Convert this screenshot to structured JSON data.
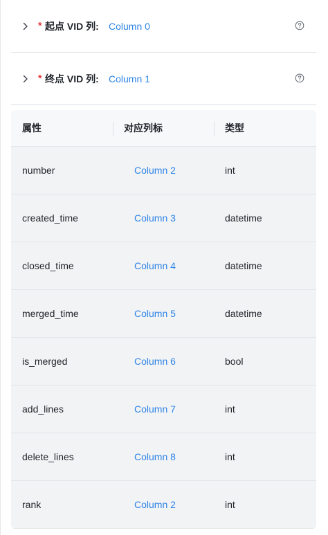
{
  "start_vid": {
    "required_mark": "*",
    "label": "起点 VID 列:",
    "value": "Column 0"
  },
  "end_vid": {
    "required_mark": "*",
    "label": "终点 VID 列:",
    "value": "Column 1"
  },
  "table": {
    "headers": {
      "property": "属性",
      "column": "对应列标",
      "type": "类型"
    },
    "rows": [
      {
        "property": "number",
        "column": "Column 2",
        "type": "int"
      },
      {
        "property": "created_time",
        "column": "Column 3",
        "type": "datetime"
      },
      {
        "property": "closed_time",
        "column": "Column 4",
        "type": "datetime"
      },
      {
        "property": "merged_time",
        "column": "Column 5",
        "type": "datetime"
      },
      {
        "property": "is_merged",
        "column": "Column 6",
        "type": "bool"
      },
      {
        "property": "add_lines",
        "column": "Column 7",
        "type": "int"
      },
      {
        "property": "delete_lines",
        "column": "Column 8",
        "type": "int"
      },
      {
        "property": "rank",
        "column": "Column 2",
        "type": "int"
      }
    ]
  },
  "colors": {
    "link": "#2e84e6",
    "required": "#e5343a",
    "text": "#1f2329"
  }
}
